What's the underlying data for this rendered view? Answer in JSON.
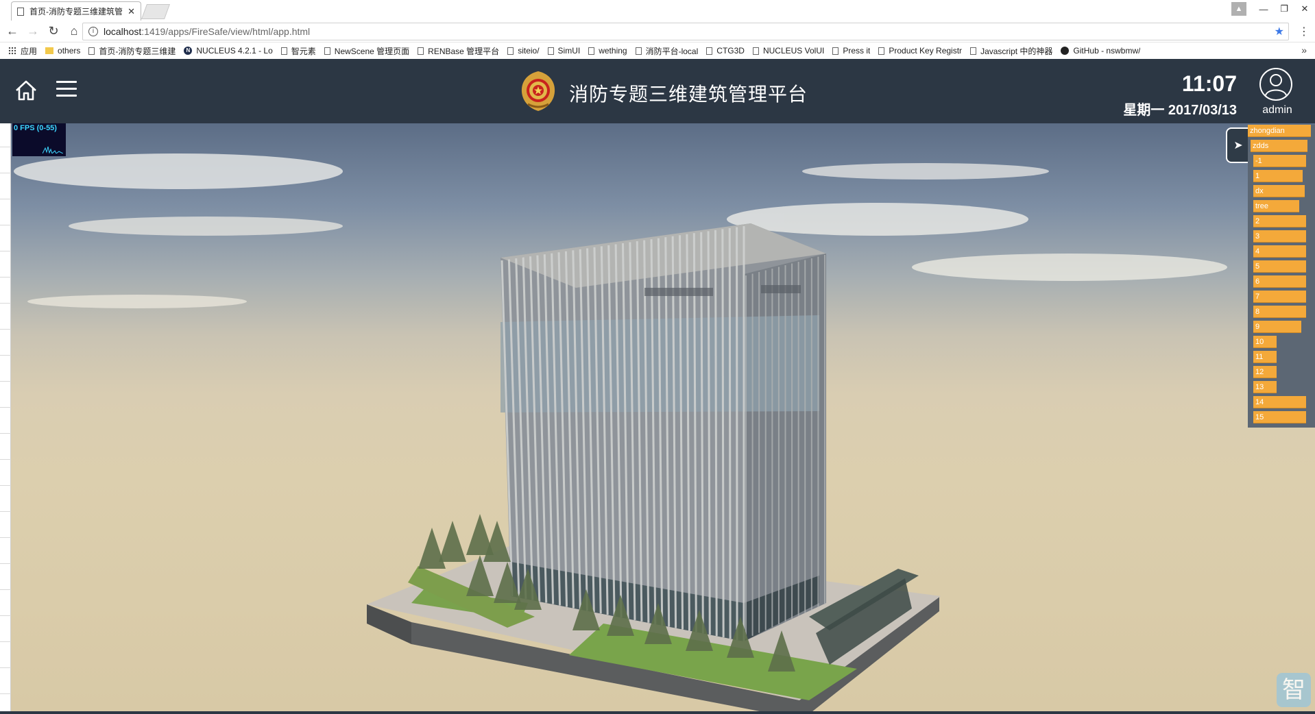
{
  "browser": {
    "tab_title": "首页-消防专题三维建筑管",
    "url_host": "localhost",
    "url_rest": ":1419/apps/FireSafe/view/html/app.html",
    "bookmarks": [
      {
        "label": "应用",
        "icon": "apps-icon"
      },
      {
        "label": "others",
        "icon": "folder-icon"
      },
      {
        "label": "首页-消防专题三维建",
        "icon": "page-icon"
      },
      {
        "label": "NUCLEUS 4.2.1 - Lo",
        "icon": "nucleus-icon"
      },
      {
        "label": "智元素",
        "icon": "page-icon"
      },
      {
        "label": "NewScene 管理页面",
        "icon": "page-icon"
      },
      {
        "label": "RENBase 管理平台",
        "icon": "page-icon"
      },
      {
        "label": "siteio/",
        "icon": "page-icon"
      },
      {
        "label": "SimUI",
        "icon": "page-icon"
      },
      {
        "label": "wething",
        "icon": "page-icon"
      },
      {
        "label": "消防平台-local",
        "icon": "page-icon"
      },
      {
        "label": "CTG3D",
        "icon": "page-icon"
      },
      {
        "label": "NUCLEUS VolUI",
        "icon": "page-icon"
      },
      {
        "label": "Press it",
        "icon": "page-icon"
      },
      {
        "label": "Product Key Registr",
        "icon": "page-icon"
      },
      {
        "label": "Javascript 中的神器",
        "icon": "page-icon"
      },
      {
        "label": "GitHub - nswbmw/",
        "icon": "github-icon"
      }
    ],
    "more_bookmarks": "»"
  },
  "app": {
    "title": "消防专题三维建筑管理平台",
    "time": "11:07",
    "date": "星期一 2017/03/13",
    "user": "admin",
    "fps_label": "0 FPS (0-55)",
    "toggle_arrow": "➤",
    "watermark": "智",
    "floors": [
      {
        "label": "zhongdian",
        "fill": 0.94
      },
      {
        "label": "zdds",
        "fill": 0.88
      },
      {
        "label": "-1",
        "fill": 0.85
      },
      {
        "label": "1",
        "fill": 0.8
      },
      {
        "label": "dx",
        "fill": 0.83
      },
      {
        "label": "tree",
        "fill": 0.74
      },
      {
        "label": "2",
        "fill": 0.86
      },
      {
        "label": "3",
        "fill": 0.86
      },
      {
        "label": "4",
        "fill": 0.86
      },
      {
        "label": "5",
        "fill": 0.86
      },
      {
        "label": "6",
        "fill": 0.86
      },
      {
        "label": "7",
        "fill": 0.86
      },
      {
        "label": "8",
        "fill": 0.86
      },
      {
        "label": "9",
        "fill": 0.78
      },
      {
        "label": "10",
        "fill": 0.38
      },
      {
        "label": "11",
        "fill": 0.38
      },
      {
        "label": "12",
        "fill": 0.38
      },
      {
        "label": "13",
        "fill": 0.38
      },
      {
        "label": "14",
        "fill": 0.86
      },
      {
        "label": "15",
        "fill": 0.86
      }
    ]
  },
  "colors": {
    "header_bg": "#2c3744",
    "floor_bar": "#f4a93a",
    "fps_text": "#3dd6ff"
  }
}
